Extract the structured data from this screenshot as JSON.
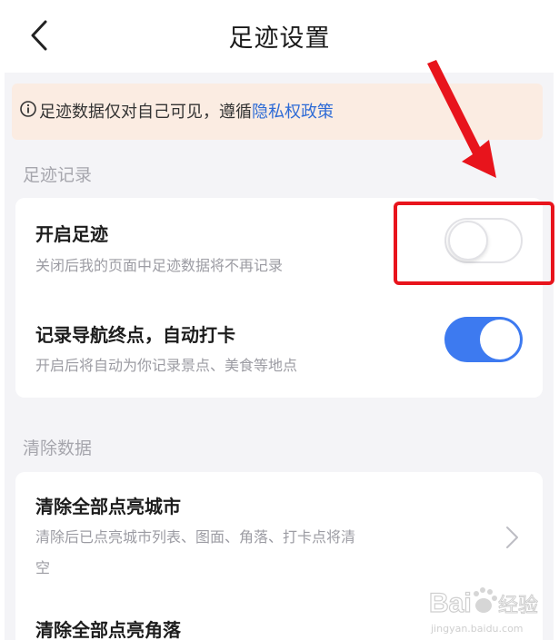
{
  "header": {
    "title": "足迹设置",
    "back_icon": "chevron-left-icon"
  },
  "notice": {
    "icon": "info-icon",
    "text": "足迹数据仅对自己可见，遵循",
    "link": "隐私权政策",
    "background": "#fbece2",
    "link_color": "#2e6bd6"
  },
  "sections": {
    "footprint": {
      "label": "足迹记录",
      "items": [
        {
          "title": "开启足迹",
          "subtitle": "关闭后我的页面中足迹数据将不再记录",
          "enabled": false
        },
        {
          "title": "记录导航终点，自动打卡",
          "subtitle": "开启后将自动为你记录景点、美食等地点",
          "enabled": true
        }
      ]
    },
    "clear": {
      "label": "清除数据",
      "items": [
        {
          "title": "清除全部点亮城市",
          "subtitle_line1": "清除后已点亮城市列表、图面、角落、打卡点将清",
          "subtitle_line2": "空"
        },
        {
          "title": "清除全部点亮角落"
        }
      ]
    }
  },
  "colors": {
    "toggle_on": "#3d7af0",
    "annotation_red": "#e8141c"
  },
  "watermark": {
    "brand": "Bai",
    "brand_tail": "经验",
    "url": "jingyan.baidu.com"
  }
}
